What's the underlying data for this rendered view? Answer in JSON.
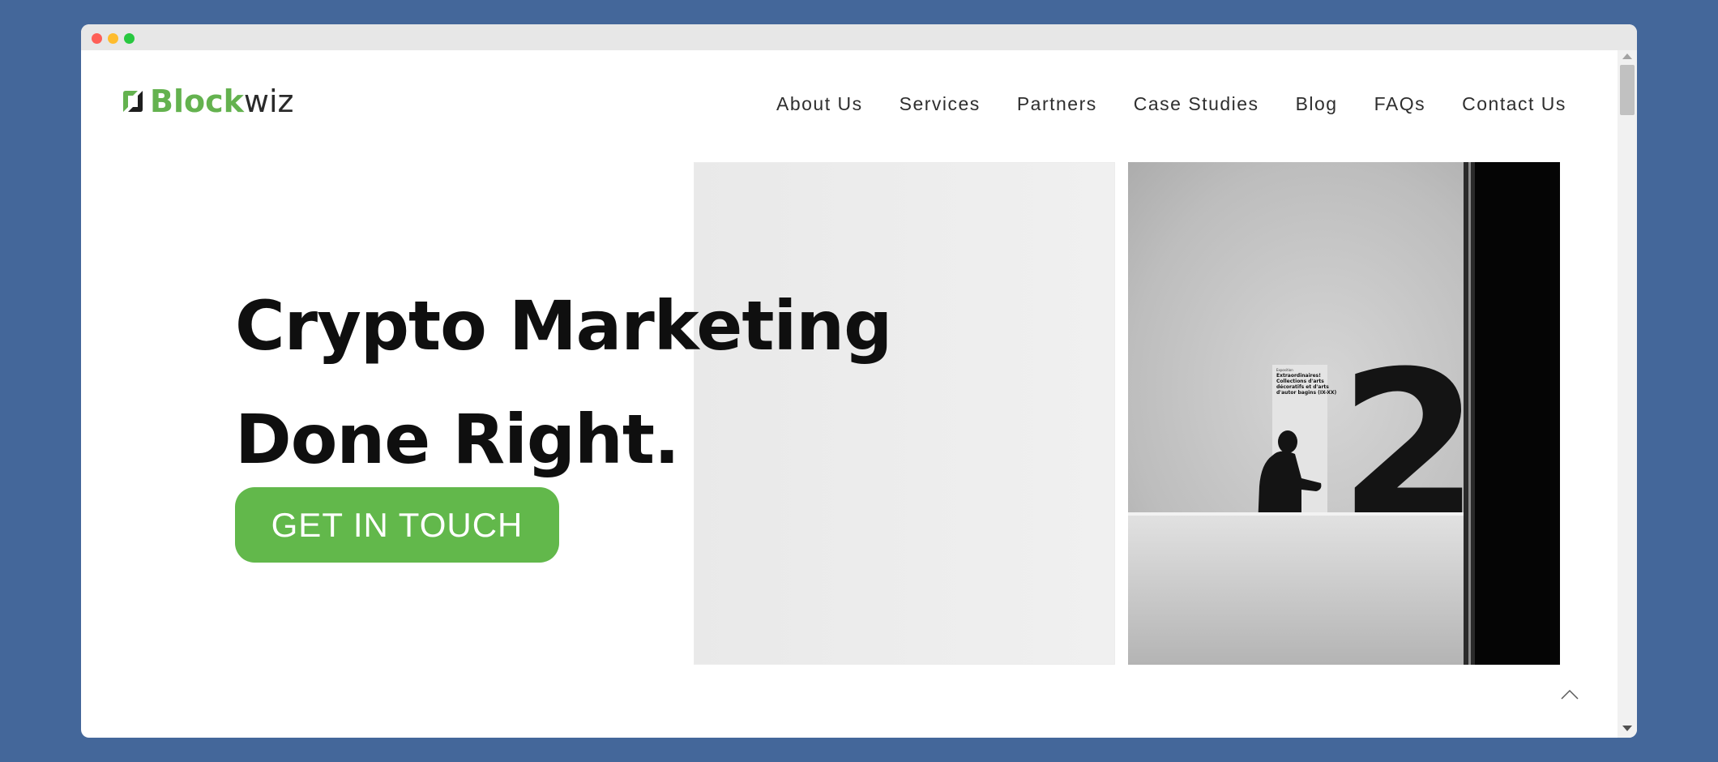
{
  "brand": {
    "name_green": "Block",
    "name_dark": "wiz",
    "green": "#64b24f",
    "background": "#44679a"
  },
  "nav": {
    "items": [
      "About Us",
      "Services",
      "Partners",
      "Case Studies",
      "Blog",
      "FAQs",
      "Contact Us"
    ]
  },
  "hero": {
    "title_line1": "Crypto Marketing",
    "title_line2": "Done Right.",
    "cta_label": "GET IN TOUCH",
    "cta_color": "#62b84b"
  },
  "poster": {
    "header": "Exposition",
    "line1": "Extraordinaires!",
    "line2": "Collections d'arts",
    "line3": "décoratifs et d'arts",
    "line4": "d'autor bagins (IX-XX)",
    "number": "2"
  },
  "icons": {
    "back_to_top": "chevron-up-icon",
    "logo_mark": "blockwiz-logo-icon"
  }
}
